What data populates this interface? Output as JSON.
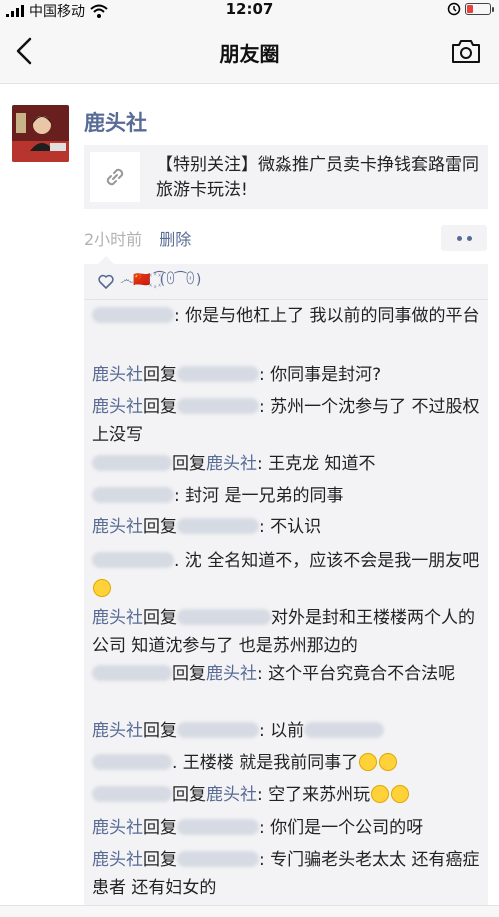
{
  "status": {
    "carrier": "中国移动",
    "time": "12:07"
  },
  "nav": {
    "title": "朋友圈"
  },
  "post": {
    "author": "鹿头社",
    "link_title": "【特别关注】微淼推广员卖卡挣钱套路雷同旅游卡玩法!",
    "time_ago": "2小时前",
    "delete_label": "删除"
  },
  "likes": {
    "names": "෴🇨🇳 ꙰ ͡(ꏿ ͡ ꏿ)"
  },
  "comments": [
    {
      "from": "",
      "to": "",
      "text": ": 你是与他杠上了 我以前的同事做的平台"
    },
    {
      "from": "鹿头社",
      "reply": "回复",
      "to": "",
      "text": ": 你同事是封河?"
    },
    {
      "from": "鹿头社",
      "reply": "回复",
      "to": "",
      "text": ": 苏州一个沈参与了 不过股权上没写"
    },
    {
      "from": "",
      "reply": "回复",
      "to": "鹿头社",
      "text": ": 王克龙 知道不"
    },
    {
      "from": "",
      "to": "",
      "text": ": 封河 是一兄弟的同事"
    },
    {
      "from": "鹿头社",
      "reply": "回复",
      "to": "",
      "text": ": 不认识"
    },
    {
      "from": "",
      "to": "",
      "text": ". 沈 全名知道不，应该不会是我一朋友吧"
    },
    {
      "from": "鹿头社",
      "reply": "回复",
      "to": "",
      "text": "对外是封和王楼楼两个人的公司 知道沈参与了 也是苏州那边的"
    },
    {
      "from": "",
      "reply": "回复",
      "to": "鹿头社",
      "text": ": 这个平台究竟合不合法呢"
    },
    {
      "from": "鹿头社",
      "reply": "回复",
      "to": "",
      "text": ": 以前"
    },
    {
      "from": "",
      "to": "",
      "text": ". 王楼楼 就是我前同事了"
    },
    {
      "from": "",
      "reply": "回复",
      "to": "鹿头社",
      "text": ": 空了来苏州玩"
    },
    {
      "from": "鹿头社",
      "reply": "回复",
      "to": "",
      "text": ": 你们是一个公司的呀"
    },
    {
      "from": "鹿头社",
      "reply": "回复",
      "to": "",
      "text": ": 专门骗老头老太太 还有癌症患者 还有妇女的"
    }
  ],
  "colors": {
    "link": "#576b95",
    "battery": "#e64340",
    "panel": "#f3f3f5"
  },
  "icons": [
    "signal-icon",
    "wifi-icon",
    "battery-icon",
    "back-icon",
    "camera-icon",
    "link-icon",
    "heart-icon",
    "more-icon",
    "emoji-icon"
  ]
}
